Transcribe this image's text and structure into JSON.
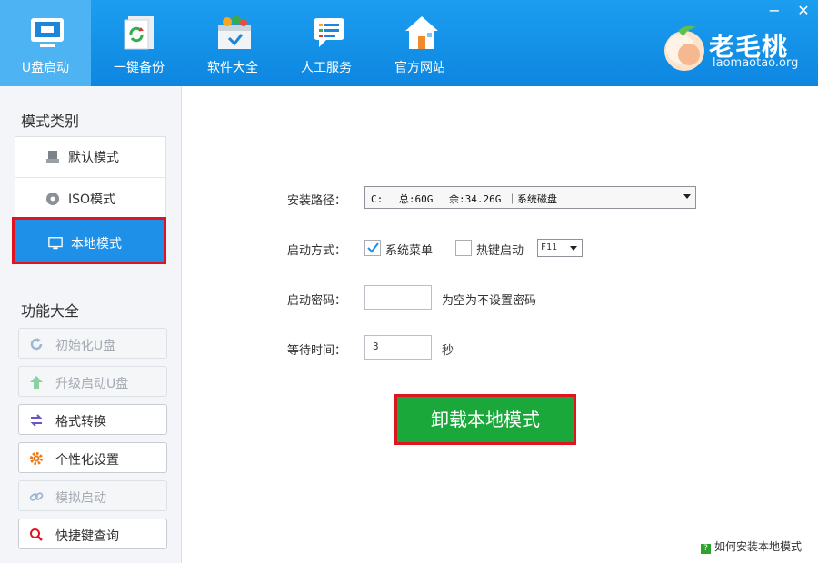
{
  "nav": [
    {
      "label": "U盘启动",
      "icon": "usb-monitor-icon"
    },
    {
      "label": "一键备份",
      "icon": "backup-icon"
    },
    {
      "label": "软件大全",
      "icon": "software-box-icon"
    },
    {
      "label": "人工服务",
      "icon": "chat-icon"
    },
    {
      "label": "官方网站",
      "icon": "house-icon"
    }
  ],
  "logo": {
    "name": "老毛桃",
    "url": "laomaotao.org"
  },
  "window": {
    "minimize": "−",
    "close": "✕"
  },
  "sidebar": {
    "mode_title": "模式类别",
    "modes": [
      {
        "label": "默认模式",
        "icon": "drive-icon"
      },
      {
        "label": "ISO模式",
        "icon": "disc-icon"
      },
      {
        "label": "本地模式",
        "icon": "monitor-icon"
      }
    ],
    "func_title": "功能大全",
    "functions": [
      {
        "label": "初始化U盘",
        "icon": "refresh-icon",
        "enabled": false
      },
      {
        "label": "升级启动U盘",
        "icon": "up-arrow-icon",
        "enabled": false
      },
      {
        "label": "格式转换",
        "icon": "swap-icon",
        "enabled": true
      },
      {
        "label": "个性化设置",
        "icon": "gear-icon",
        "enabled": true
      },
      {
        "label": "模拟启动",
        "icon": "link-icon",
        "enabled": false
      },
      {
        "label": "快捷键查询",
        "icon": "search-icon",
        "enabled": true
      }
    ]
  },
  "form": {
    "path_label": "安装路径：",
    "path_value": "C: ｜总:60G ｜余:34.26G ｜系统磁盘",
    "boot_label": "启动方式：",
    "opt_menu": "系统菜单",
    "opt_menu_checked": true,
    "opt_hotkey": "热键启动",
    "opt_hotkey_checked": false,
    "hotkey_value": "F11",
    "pwd_label": "启动密码：",
    "pwd_value": "",
    "pwd_hint": "为空为不设置密码",
    "wait_label": "等待时间：",
    "wait_value": "3",
    "wait_unit": "秒"
  },
  "action": {
    "label": "卸载本地模式"
  },
  "help": {
    "label": "如何安装本地模式"
  },
  "colors": {
    "topbar": "#1496ea",
    "selected": "#1e90e8",
    "highlight": "#e0141e",
    "button": "#1aa83a"
  }
}
